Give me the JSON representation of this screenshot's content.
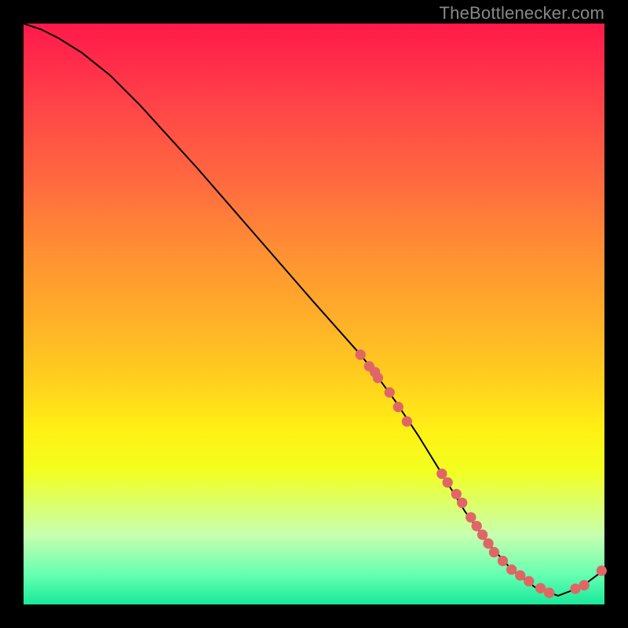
{
  "attribution": "TheBottlenecker.com",
  "chart_data": {
    "type": "line",
    "title": "",
    "xlabel": "",
    "ylabel": "",
    "xlim": [
      0,
      100
    ],
    "ylim": [
      0,
      100
    ],
    "series": [
      {
        "name": "main-curve",
        "color": "#000000",
        "x": [
          0,
          3,
          6,
          10,
          15,
          20,
          30,
          40,
          50,
          58,
          60,
          64,
          68,
          72,
          76,
          80,
          84,
          88,
          92,
          96,
          100
        ],
        "y": [
          100,
          99,
          97.5,
          95,
          91,
          86,
          75,
          63.5,
          52,
          43,
          40.5,
          35,
          29,
          22.5,
          16,
          10.5,
          6,
          3,
          1.5,
          3,
          6
        ]
      }
    ],
    "highlight_points_segment1": {
      "color": "#e06666",
      "x": [
        58,
        59.5,
        60.5,
        61,
        63,
        64.5,
        66
      ],
      "y": [
        43,
        41,
        40,
        39,
        36.5,
        34,
        31.5
      ]
    },
    "highlight_points_segment2": {
      "color": "#e06666",
      "x": [
        72,
        73,
        74.5,
        75.5,
        77,
        78,
        79,
        80,
        81,
        82.5,
        84,
        85.5,
        87,
        89,
        90.5,
        95,
        96.5,
        99.5
      ],
      "y": [
        22.5,
        21,
        19,
        17.5,
        15,
        13.5,
        12,
        10.5,
        9,
        7.5,
        6,
        5,
        4,
        2.8,
        2,
        2.7,
        3.3,
        5.8
      ]
    }
  }
}
